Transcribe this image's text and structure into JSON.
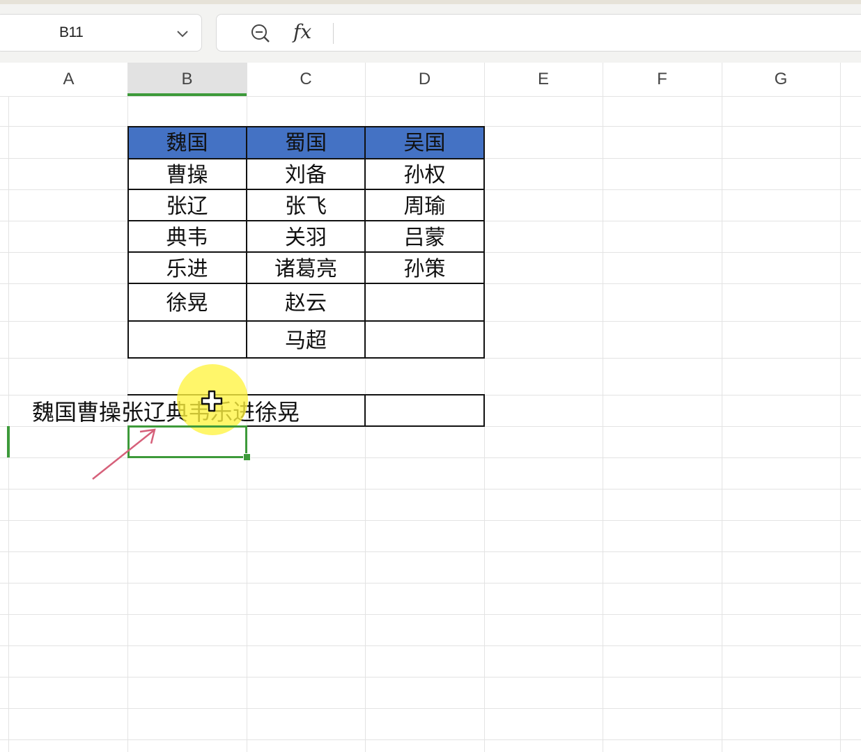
{
  "formula_bar": {
    "name_box": "B11",
    "fx_label": "fx",
    "formula_value": ""
  },
  "columns": [
    "A",
    "B",
    "C",
    "D",
    "E",
    "F",
    "G"
  ],
  "active_column": "B",
  "table": {
    "headers": [
      "魏国",
      "蜀国",
      "吴国"
    ],
    "header_color": "#4472c4",
    "rows": [
      [
        "曹操",
        "刘备",
        "孙权"
      ],
      [
        "张辽",
        "张飞",
        "周瑜"
      ],
      [
        "典韦",
        "关羽",
        "吕蒙"
      ],
      [
        "乐进",
        "诸葛亮",
        "孙策"
      ],
      [
        "徐晃",
        "赵云",
        ""
      ],
      [
        "",
        "马超",
        ""
      ]
    ]
  },
  "row9_text": "魏国曹操张辽典韦乐进徐晃",
  "selected_cell": "B11",
  "selection_color": "#3d9a3a",
  "icons": {
    "name_box_dropdown": "chevron-down-icon",
    "zoom": "zoom-out-icon",
    "cursor": "move-cursor-icon",
    "annotation": "arrow-annotation-icon"
  }
}
